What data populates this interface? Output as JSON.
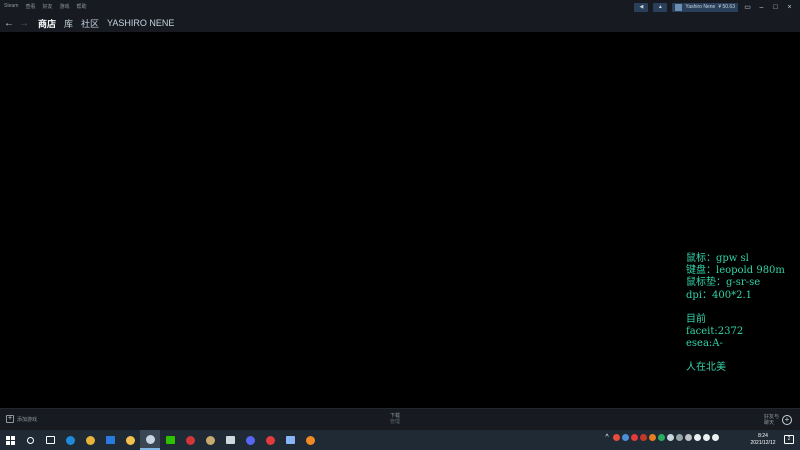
{
  "titlebar": {
    "menu": [
      "Steam",
      "查看",
      "好友",
      "游戏",
      "帮助"
    ],
    "account_name": "Yashiro Nene",
    "wallet": "¥ 50.63"
  },
  "nav": {
    "back_glyph": "←",
    "forward_glyph": "→",
    "tabs": [
      "商店",
      "库",
      "社区",
      "YASHIRO NENE"
    ]
  },
  "overlay": {
    "mouse": "鼠标：gpw sl",
    "keyboard": "键盘：leopold 980m",
    "mousepad": "鼠标垫：g-sr-se",
    "dpi": "dpi：400*2.1",
    "current": "目前",
    "faceit": "faceit:2372",
    "esea": "esea:A-",
    "location": "人在北美"
  },
  "bottombar": {
    "add_game": "添加游戏",
    "downloads": "下载",
    "downloads_sub": "管理",
    "friends_line1": "好友与",
    "friends_line2": "聊天"
  },
  "taskbar": {
    "icons": [
      {
        "name": "edge-icon",
        "color": "#1f8ad8"
      },
      {
        "name": "chrome-icon",
        "color": "#e8b33a"
      },
      {
        "name": "outlook-icon",
        "color": "#2a7be0"
      },
      {
        "name": "file-explorer-icon",
        "color": "#f2c14e"
      },
      {
        "name": "steam-icon",
        "color": "#c7d5e0"
      },
      {
        "name": "wechat-icon",
        "color": "#2dc100"
      },
      {
        "name": "riot-vanguard-icon",
        "color": "#d13639"
      },
      {
        "name": "league-icon",
        "color": "#c8aa6e"
      },
      {
        "name": "clock-app-icon",
        "color": "#cfd8dc"
      },
      {
        "name": "discord-icon",
        "color": "#5865f2"
      },
      {
        "name": "netease-music-icon",
        "color": "#e33b3b"
      },
      {
        "name": "app-circle-icon",
        "color": "#8ab4f8"
      },
      {
        "name": "obs-icon",
        "color": "#f08a24"
      }
    ],
    "tray_icons": [
      {
        "name": "tray-red-icon",
        "color": "#e74c3c"
      },
      {
        "name": "tray-blue-icon",
        "color": "#4a90d9"
      },
      {
        "name": "tray-netease-icon",
        "color": "#e33b3b"
      },
      {
        "name": "tray-red2-icon",
        "color": "#c0392b"
      },
      {
        "name": "tray-orange-icon",
        "color": "#e67e22"
      },
      {
        "name": "tray-green-icon",
        "color": "#27ae60"
      },
      {
        "name": "tray-steam-icon",
        "color": "#c7d5e0"
      },
      {
        "name": "tray-gray-icon",
        "color": "#95a5a6"
      },
      {
        "name": "tray-display-icon",
        "color": "#bdc3c7"
      },
      {
        "name": "tray-wifi-icon",
        "color": "#ecf0f1"
      },
      {
        "name": "tray-volume-icon",
        "color": "#ecf0f1"
      },
      {
        "name": "tray-ime-icon",
        "color": "#ecf0f1"
      }
    ],
    "time": "8:24",
    "date": "2021/12/12",
    "notif_count": "2"
  }
}
